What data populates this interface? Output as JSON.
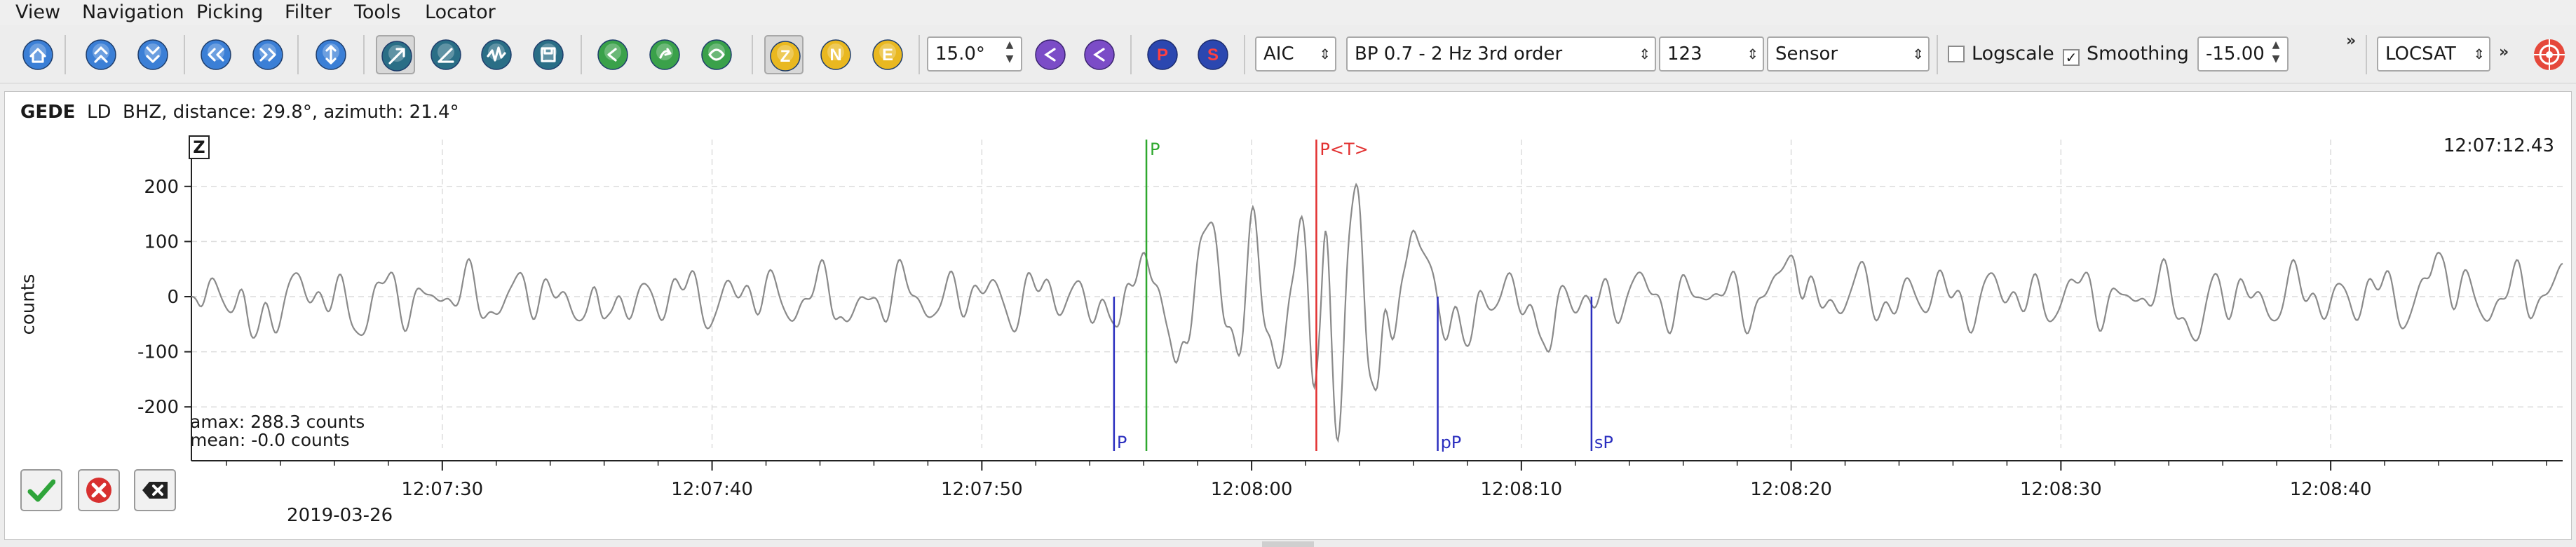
{
  "menu": [
    "View",
    "Navigation",
    "Picking",
    "Filter",
    "Tools",
    "Locator"
  ],
  "toolbar": {
    "icons": [
      {
        "name": "home-icon",
        "color": "#3b7fd6"
      },
      {
        "name": "scroll-up-icon",
        "color": "#3b7fd6"
      },
      {
        "name": "scroll-down-icon",
        "color": "#3b7fd6"
      },
      {
        "name": "scroll-left-icon",
        "color": "#3b7fd6"
      },
      {
        "name": "scroll-right-icon",
        "color": "#3b7fd6"
      },
      {
        "name": "zoom-vertical-icon",
        "color": "#3b7fd6"
      },
      {
        "name": "align-icon",
        "color": "#2a6e86"
      },
      {
        "name": "angle-icon",
        "color": "#2a6e86"
      },
      {
        "name": "waveform-icon",
        "color": "#2a6e86"
      },
      {
        "name": "save-trace-icon",
        "color": "#2a6e86"
      },
      {
        "name": "pick-prev-icon",
        "color": "#3aa14a"
      },
      {
        "name": "pick-next-icon",
        "color": "#3aa14a"
      },
      {
        "name": "pick-relocate-icon",
        "color": "#3aa14a"
      },
      {
        "name": "component-z-icon",
        "color": "#e9b820",
        "label": "Z"
      },
      {
        "name": "component-n-icon",
        "color": "#e9b820",
        "label": "N"
      },
      {
        "name": "component-e-icon",
        "color": "#e9b820",
        "label": "E"
      }
    ],
    "rotation_value": "15.0°",
    "phase_icons": [
      {
        "name": "phase-p-icon",
        "color": "#2b47b0",
        "label": "P"
      },
      {
        "name": "phase-s-icon",
        "color": "#2b47b0",
        "label": "S"
      }
    ],
    "picker": "AIC",
    "filter": "BP 0.7 - 2 Hz  3rd order",
    "stream": "123",
    "unit": "Sensor",
    "logscale_label": "Logscale",
    "logscale_checked": false,
    "smoothing_label": "Smoothing",
    "smoothing_checked": true,
    "smoothing_value": "-15.00",
    "locator": "LOCSAT"
  },
  "trace": {
    "station": "GEDE",
    "location": "LD",
    "channel": "BHZ, distance: 29.8°, azimuth: 21.4°",
    "component_box": "Z",
    "ylabel": "counts",
    "time_right": "12:07:12.43",
    "amax": "amax: 288.3 counts",
    "mean": "mean: -0.0 counts",
    "date": "2019-03-26"
  },
  "chart_data": {
    "type": "line",
    "title": "",
    "xlabel": "",
    "ylabel": "counts",
    "xlim": [
      "12:07:20.7",
      "12:08:48.6"
    ],
    "ylim": [
      -290,
      290
    ],
    "y_ticks": [
      200,
      100,
      0,
      -100,
      -200
    ],
    "x_ticks": [
      {
        "t": 30,
        "label": "12:07:30"
      },
      {
        "t": 40,
        "label": "12:07:40"
      },
      {
        "t": 50,
        "label": "12:07:50"
      },
      {
        "t": 60,
        "label": "12:08:00"
      },
      {
        "t": 70,
        "label": "12:08:10"
      },
      {
        "t": 80,
        "label": "12:08:20"
      },
      {
        "t": 90,
        "label": "12:08:30"
      },
      {
        "t": 100,
        "label": "12:08:40"
      }
    ],
    "grid": true,
    "series": [
      {
        "color": "#8a8a8a",
        "x_start": "12:07:20.7",
        "x_end": "12:08:48.6",
        "keypoints": [
          {
            "t": 20.7,
            "v": 0
          },
          {
            "t": 23.0,
            "v": -75
          },
          {
            "t": 27.0,
            "v": -70
          },
          {
            "t": 36.0,
            "v": -40
          },
          {
            "t": 45.0,
            "v": -45
          },
          {
            "t": 55.0,
            "v": -55
          },
          {
            "t": 56.0,
            "v": 80
          },
          {
            "t": 57.2,
            "v": -120
          },
          {
            "t": 58.5,
            "v": 135
          },
          {
            "t": 61.0,
            "v": -130
          },
          {
            "t": 62.0,
            "v": 200
          },
          {
            "t": 62.4,
            "v": -200
          },
          {
            "t": 62.9,
            "v": 260
          },
          {
            "t": 63.2,
            "v": -270
          },
          {
            "t": 63.9,
            "v": 210
          },
          {
            "t": 64.6,
            "v": -170
          },
          {
            "t": 66.0,
            "v": 120
          },
          {
            "t": 68.0,
            "v": -90
          },
          {
            "t": 71.0,
            "v": -100
          },
          {
            "t": 80.0,
            "v": 75
          },
          {
            "t": 95.0,
            "v": -80
          },
          {
            "t": 104.0,
            "v": 80
          },
          {
            "t": 108.6,
            "v": 60
          }
        ]
      }
    ],
    "picks": [
      {
        "label": "P",
        "time": "12:07:56.1",
        "t": 56.1,
        "color": "#2ea82e",
        "side": "top"
      },
      {
        "label": "P<T>",
        "time": "12:08:02.4",
        "t": 62.4,
        "color": "#e23030",
        "side": "top"
      },
      {
        "label": "P",
        "time": "12:07:54.9",
        "t": 54.9,
        "color": "#2b2fbf",
        "side": "bottom"
      },
      {
        "label": "pP",
        "time": "12:08:06.9",
        "t": 66.9,
        "color": "#2b2fbf",
        "side": "bottom"
      },
      {
        "label": "sP",
        "time": "12:08:12.6",
        "t": 72.6,
        "color": "#2b2fbf",
        "side": "bottom"
      }
    ]
  }
}
